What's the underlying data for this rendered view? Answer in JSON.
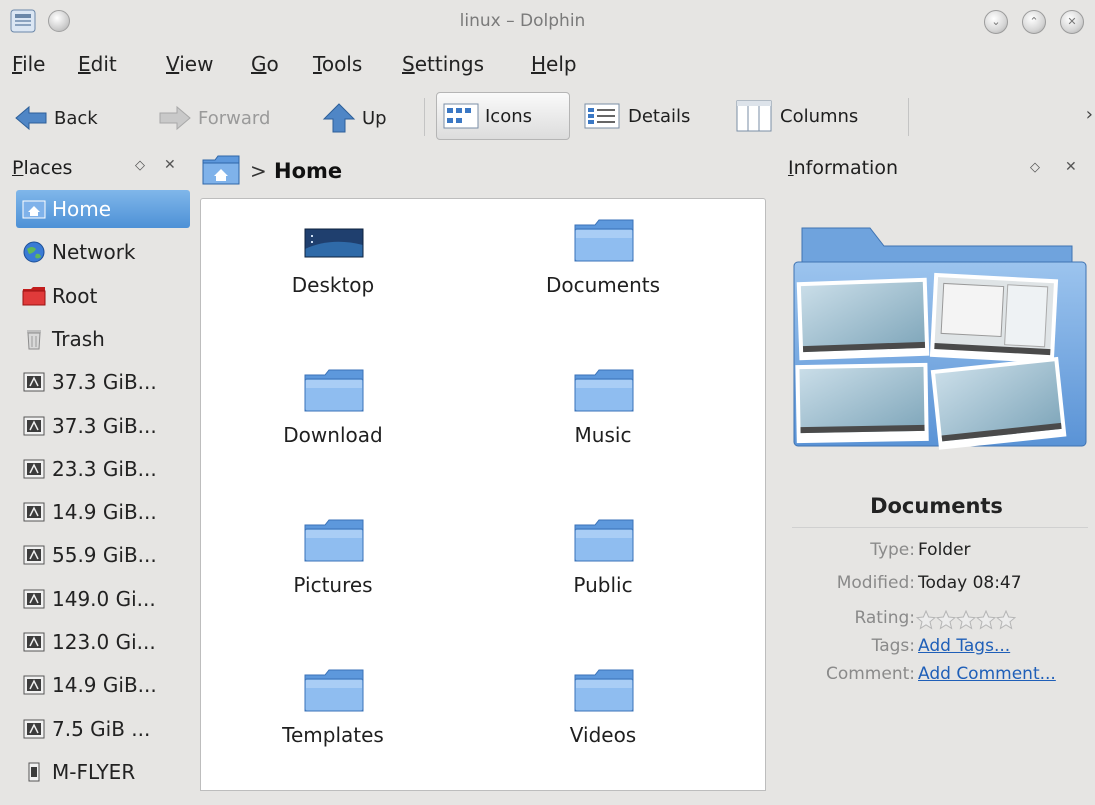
{
  "window": {
    "title": "linux – Dolphin"
  },
  "menu": [
    "File",
    "Edit",
    "View",
    "Go",
    "Tools",
    "Settings",
    "Help"
  ],
  "menu_accel": [
    "F",
    "E",
    "V",
    "G",
    "T",
    "S",
    "H"
  ],
  "toolbar": {
    "back": "Back",
    "forward": "Forward",
    "up": "Up",
    "icons": "Icons",
    "details": "Details",
    "columns": "Columns",
    "more": "›"
  },
  "places": {
    "title": "Places",
    "items": [
      {
        "label": "Home",
        "icon": "home-icon",
        "selected": true
      },
      {
        "label": "Network",
        "icon": "network-icon"
      },
      {
        "label": "Root",
        "icon": "root-folder-icon"
      },
      {
        "label": "Trash",
        "icon": "trash-icon"
      },
      {
        "label": "37.3 GiB...",
        "icon": "drive-icon"
      },
      {
        "label": "37.3 GiB...",
        "icon": "drive-icon"
      },
      {
        "label": "23.3 GiB...",
        "icon": "drive-icon"
      },
      {
        "label": "14.9 GiB...",
        "icon": "drive-icon"
      },
      {
        "label": "55.9 GiB...",
        "icon": "drive-icon"
      },
      {
        "label": "149.0 Gi...",
        "icon": "drive-icon"
      },
      {
        "label": "123.0 Gi...",
        "icon": "drive-icon"
      },
      {
        "label": "14.9 GiB...",
        "icon": "drive-icon"
      },
      {
        "label": "7.5 GiB ...",
        "icon": "drive-icon"
      },
      {
        "label": "M-FLYER",
        "icon": "usb-drive-icon"
      }
    ]
  },
  "location": {
    "path": "Home",
    "separator": ">"
  },
  "files": [
    {
      "name": "Desktop",
      "icon": "desktop-folder-icon"
    },
    {
      "name": "Documents",
      "icon": "folder-icon"
    },
    {
      "name": "Download",
      "icon": "folder-icon"
    },
    {
      "name": "Music",
      "icon": "folder-icon"
    },
    {
      "name": "Pictures",
      "icon": "folder-icon"
    },
    {
      "name": "Public",
      "icon": "folder-icon"
    },
    {
      "name": "Templates",
      "icon": "folder-icon"
    },
    {
      "name": "Videos",
      "icon": "folder-icon"
    }
  ],
  "information": {
    "title": "Information",
    "name": "Documents",
    "type_label": "Type:",
    "type_value": "Folder",
    "modified_label": "Modified:",
    "modified_value": "Today 08:47",
    "rating_label": "Rating:",
    "rating_value": 0,
    "rating_max": 5,
    "tags_label": "Tags:",
    "tags_value": "Add Tags...",
    "comment_label": "Comment:",
    "comment_value": "Add Comment..."
  },
  "colors": {
    "selection": "#4d91d6",
    "folder": "#7fb0e8",
    "link": "#1f5fb8",
    "window_bg": "#e6e5e3"
  }
}
